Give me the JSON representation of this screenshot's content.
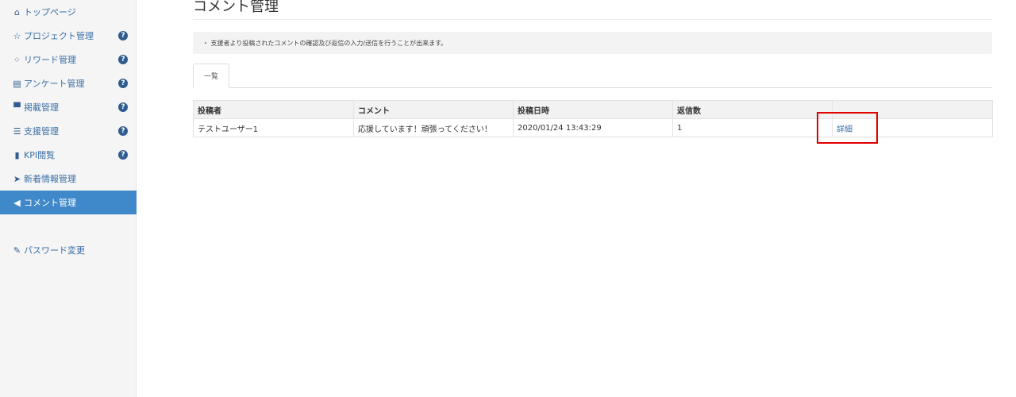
{
  "sidebar": {
    "items": [
      {
        "label": "トップページ",
        "icon": "home-icon",
        "glyph": "⌂",
        "help": false
      },
      {
        "label": "プロジェクト管理",
        "icon": "star-icon",
        "glyph": "☆",
        "help": true
      },
      {
        "label": "リワード管理",
        "icon": "gift-icon",
        "glyph": "⁘",
        "help": true
      },
      {
        "label": "アンケート管理",
        "icon": "list-alt-icon",
        "glyph": "▤",
        "help": true
      },
      {
        "label": "掲載管理",
        "icon": "billboard-icon",
        "glyph": "▀",
        "help": true
      },
      {
        "label": "支援管理",
        "icon": "list-icon",
        "glyph": "☰",
        "help": true
      },
      {
        "label": "KPI閲覧",
        "icon": "bar-chart-icon",
        "glyph": "▮",
        "help": true
      },
      {
        "label": "新着情報管理",
        "icon": "send-icon",
        "glyph": "➤",
        "help": false
      },
      {
        "label": "コメント管理",
        "icon": "bullhorn-icon",
        "glyph": "◀",
        "help": false
      },
      {
        "label": "パスワード変更",
        "icon": "wrench-icon",
        "glyph": "✎",
        "help": false
      }
    ],
    "help_glyph": "?",
    "active_index": 8
  },
  "main": {
    "title": "コメント管理",
    "notice": "・ 支援者より投稿されたコメントの確認及び返信の入力/送信を行うことが出来ます。",
    "tab_label": "一覧",
    "table": {
      "headers": [
        "投稿者",
        "コメント",
        "投稿日時",
        "返信数",
        ""
      ],
      "rows": [
        {
          "author": "テストユーザー1",
          "comment": "応援しています！頑張ってください！",
          "posted_at": "2020/01/24 13:43:29",
          "replies": "1",
          "action": "詳細"
        }
      ]
    }
  },
  "colors": {
    "accent": "#3f88c9",
    "link": "#3b6fa6",
    "highlight": "#e00000"
  }
}
